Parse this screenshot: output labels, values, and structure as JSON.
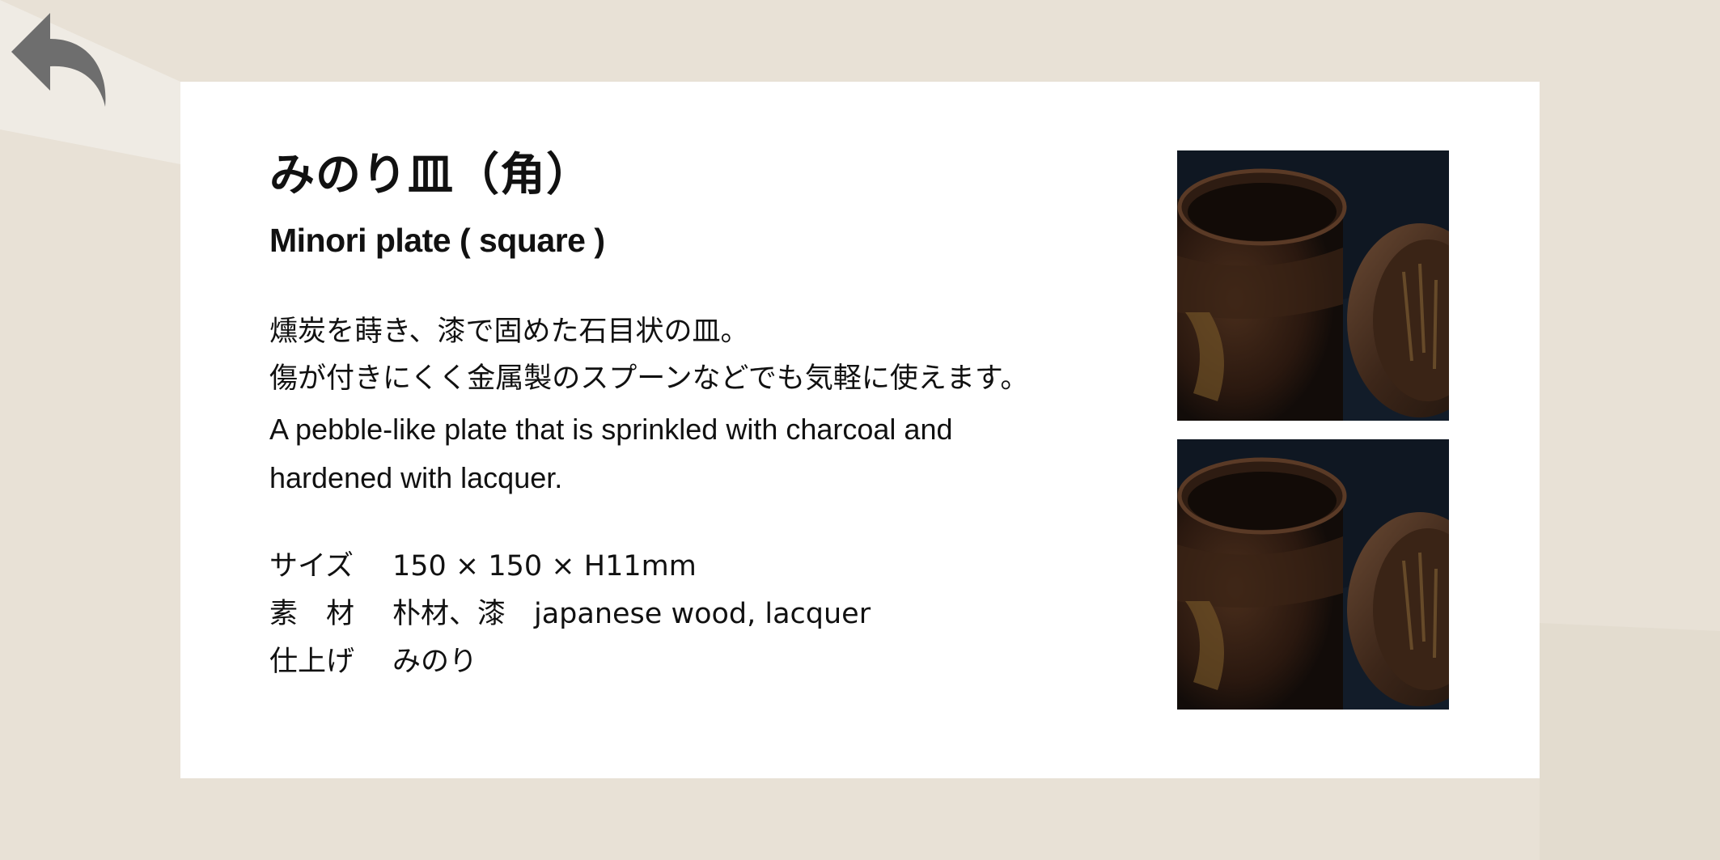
{
  "navigation": {
    "back_icon": "undo-arrow-icon"
  },
  "product": {
    "title_ja": "みのり皿（角）",
    "title_en": "Minori plate ( square )",
    "description_ja": [
      "燻炭を蒔き、漆で固めた石目状の皿。",
      "傷が付きにくく金属製のスプーンなどでも気軽に使えます。"
    ],
    "description_en": "A pebble-like plate that is sprinkled with charcoal and hardened with lacquer.",
    "specs": [
      {
        "label": "サイズ",
        "value": "150 × 150 × H11mm"
      },
      {
        "label": "素　材",
        "value": "朴材、漆　japanese wood, lacquer"
      },
      {
        "label": "仕上げ",
        "value": "みのり"
      }
    ]
  },
  "gallery": {
    "images": [
      {
        "subject": "lacquered-wooden-container-photo"
      },
      {
        "subject": "lacquered-wooden-container-photo"
      }
    ]
  },
  "colors": {
    "background": "#e8e1d6",
    "card": "#ffffff",
    "back_icon": "#6e6e6e",
    "text": "#111111"
  }
}
